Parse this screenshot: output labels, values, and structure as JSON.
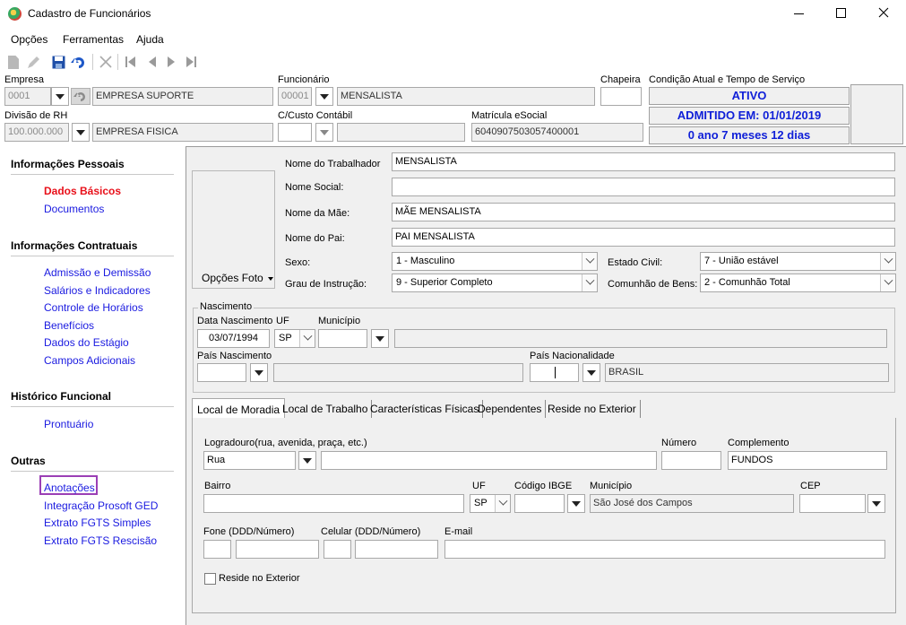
{
  "window": {
    "title": "Cadastro de Funcionários"
  },
  "menu": {
    "items": [
      "Opções",
      "Ferramentas",
      "Ajuda"
    ]
  },
  "header": {
    "empresa_label": "Empresa",
    "empresa_code": "0001",
    "empresa_name": "EMPRESA SUPORTE",
    "divisao_label": "Divisão de RH",
    "divisao_code": "100.000.000",
    "divisao_name": "EMPRESA FISICA",
    "funcionario_label": "Funcionário",
    "funcionario_code": "00001",
    "funcionario_name": "MENSALISTA",
    "custo_label": "C/Custo Contábil",
    "custo_code": "",
    "custo_name": "",
    "chapeira_label": "Chapeira",
    "chapeira_value": "",
    "matricula_label": "Matrícula eSocial",
    "matricula_value": "6040907503057400001",
    "condicao_label": "Condição Atual e Tempo de Serviço",
    "status": "ATIVO",
    "admitido": "ADMITIDO EM: 01/01/2019",
    "tempo": "0 ano 7 meses 12 dias"
  },
  "sidebar": {
    "sections": [
      {
        "title": "Informações Pessoais",
        "items": [
          "Dados Básicos",
          "Documentos"
        ]
      },
      {
        "title": "Informações Contratuais",
        "items": [
          "Admissão e Demissão",
          "Salários e Indicadores",
          "Controle de Horários",
          "Benefícios",
          "Dados do Estágio",
          "Campos Adicionais"
        ]
      },
      {
        "title": "Histórico Funcional",
        "items": [
          "Prontuário"
        ]
      },
      {
        "title": "Outras",
        "items": [
          "Anotações",
          "Integração Prosoft GED",
          "Extrato FGTS Simples",
          "Extrato FGTS Rescisão"
        ]
      }
    ]
  },
  "basic": {
    "foto_label": "Opções Foto",
    "nome_trab_label": "Nome do Trabalhador",
    "nome_trab": "MENSALISTA",
    "nome_social_label": "Nome Social:",
    "nome_social": "",
    "nome_mae_label": "Nome da Mãe:",
    "nome_mae": "MÃE MENSALISTA",
    "nome_pai_label": "Nome do Pai:",
    "nome_pai": "PAI MENSALISTA",
    "sexo_label": "Sexo:",
    "sexo": "1 - Masculino",
    "estado_civil_label": "Estado Civil:",
    "estado_civil": "7 - União estável",
    "grau_label": "Grau de Instrução:",
    "grau": "9 - Superior Completo",
    "comunhao_label": "Comunhão de Bens:",
    "comunhao": "2 - Comunhão Total"
  },
  "nascimento": {
    "group_label": "Nascimento",
    "data_label": "Data Nascimento",
    "data": "03/07/1994",
    "uf_label": "UF",
    "uf": "SP",
    "municipio_label": "Município",
    "municipio": "",
    "pais_nasc_label": "País Nascimento",
    "pais_nasc": "",
    "pais_nac_label": "País Nacionalidade",
    "pais_nac": "BRASIL"
  },
  "tabs": [
    "Local de Moradia",
    "Local de Trabalho",
    "Características Físicas",
    "Dependentes",
    "Reside no Exterior"
  ],
  "moradia": {
    "logradouro_label": "Logradouro(rua, avenida, praça, etc.)",
    "logradouro_tipo": "Rua",
    "logradouro": "",
    "numero_label": "Número",
    "numero": "",
    "complemento_label": "Complemento",
    "complemento": "FUNDOS",
    "bairro_label": "Bairro",
    "bairro": "",
    "uf_label": "UF",
    "uf": "SP",
    "ibge_label": "Código IBGE",
    "ibge": "",
    "municipio_label": "Município",
    "municipio": "São José dos Campos",
    "cep_label": "CEP",
    "cep": "",
    "fone_label": "Fone (DDD/Número)",
    "celular_label": "Celular (DDD/Número)",
    "email_label": "E-mail",
    "reside_label": "Reside no Exterior"
  },
  "colors": {
    "accent_link": "#1a1ae0",
    "active_link": "#e8101a",
    "status_text": "#1020d8",
    "highlight_border": "#9b3fb5"
  }
}
